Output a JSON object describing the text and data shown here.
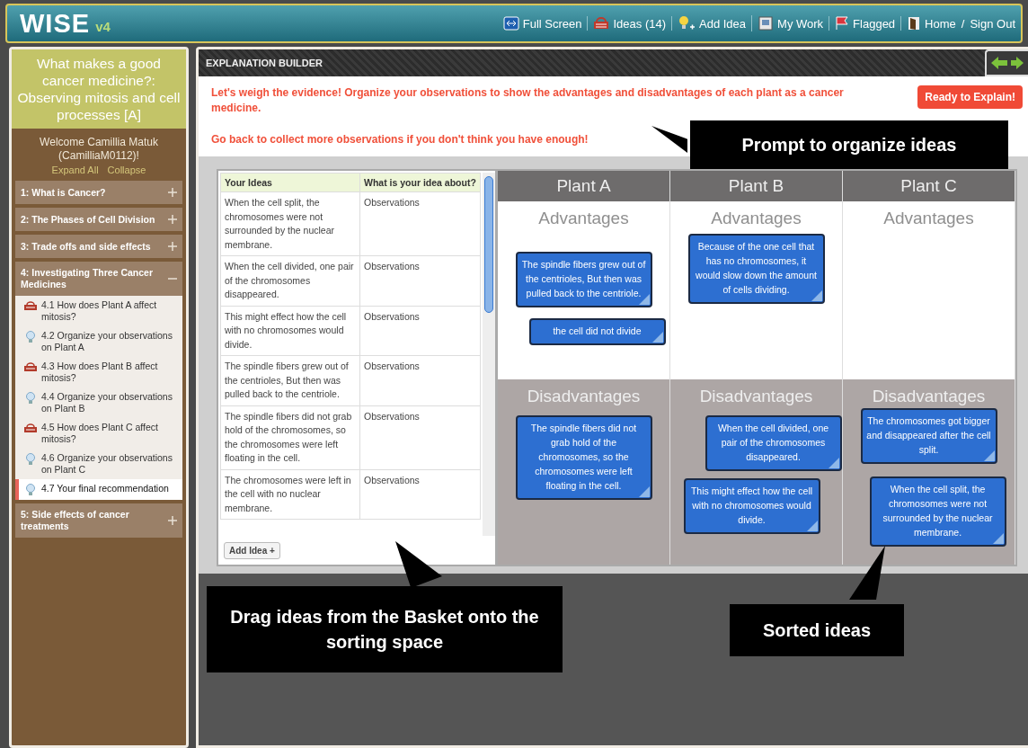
{
  "app": {
    "logo": "WISE",
    "version": "v4"
  },
  "nav": [
    {
      "kind": "fullscreen",
      "label": "Full Screen"
    },
    {
      "kind": "basket",
      "label": "Ideas (14)"
    },
    {
      "kind": "bulb",
      "label": "Add Idea"
    },
    {
      "kind": "notebook",
      "label": "My Work"
    },
    {
      "kind": "flag",
      "label": "Flagged"
    },
    {
      "kind": "door",
      "label": "Home"
    },
    {
      "kind": "slash",
      "label": "/"
    },
    {
      "kind": "plain",
      "label": "Sign Out"
    }
  ],
  "project": {
    "title": "What makes a good cancer medicine?: Observing mitosis and cell processes [A]",
    "welcome": "Welcome Camillia Matuk (CamilliaM0112)!",
    "expand_all": "Expand All",
    "collapse": "Collapse"
  },
  "sections": [
    {
      "title": "1: What is Cancer?",
      "expanded": false
    },
    {
      "title": "2: The Phases of Cell Division",
      "expanded": false
    },
    {
      "title": "3: Trade offs and side effects",
      "expanded": false
    },
    {
      "title": "4: Investigating Three Cancer Medicines",
      "expanded": true,
      "steps": [
        {
          "kind": "basket",
          "label": "4.1 How does Plant A affect mitosis?",
          "selected": false
        },
        {
          "kind": "bulb",
          "label": "4.2 Organize your observations on Plant A",
          "selected": false
        },
        {
          "kind": "basket",
          "label": "4.3 How does Plant B affect mitosis?",
          "selected": false
        },
        {
          "kind": "bulb",
          "label": "4.4 Organize your observations on Plant B",
          "selected": false
        },
        {
          "kind": "basket",
          "label": "4.5 How does Plant C affect mitosis?",
          "selected": false
        },
        {
          "kind": "bulb",
          "label": "4.6 Organize your observations on Plant C",
          "selected": false
        },
        {
          "kind": "bulb",
          "label": "4.7 Your final recommendation",
          "selected": true
        }
      ]
    },
    {
      "title": "5: Side effects of cancer treatments",
      "expanded": false
    }
  ],
  "step": {
    "title": "EXPLANATION BUILDER",
    "prompt": [
      "Let's weigh the evidence! Organize your observations to show the advantages and disadvantages of each plant as a cancer medicine.",
      "Go back to collect more observations if you don't think you have enough!"
    ],
    "ready_button": "Ready to Explain!"
  },
  "ideas_table": {
    "columns": [
      "Your Ideas",
      "What is your idea about?"
    ],
    "rows": [
      {
        "idea": "When the cell split, the chromosomes were not surrounded by the nuclear membrane.",
        "about": "Observations"
      },
      {
        "idea": "When the cell divided, one pair of the chromosomes disappeared.",
        "about": "Observations"
      },
      {
        "idea": "This might effect how the cell with no chromosomes would divide.",
        "about": "Observations"
      },
      {
        "idea": "The spindle fibers grew out of the centrioles, But then was pulled back to the centriole.",
        "about": "Observations"
      },
      {
        "idea": "The spindle fibers did not grab hold of the chromosomes, so the chromosomes were left floating in the cell.",
        "about": "Observations"
      },
      {
        "idea": "The chromosomes were left in the cell with no nuclear membrane.",
        "about": "Observations"
      }
    ],
    "add_button": "Add Idea +"
  },
  "board": {
    "columns": [
      {
        "title": "Plant A",
        "advantages_label": "Advantages",
        "disadvantages_label": "Disadvantages",
        "advantages": [
          "The spindle fibers grew out of the centrioles, But then was pulled back to the centriole.",
          "the cell did not divide"
        ],
        "disadvantages": [
          "The spindle fibers did not grab hold of the chromosomes, so the chromosomes were left floating in the cell."
        ]
      },
      {
        "title": "Plant B",
        "advantages_label": "Advantages",
        "disadvantages_label": "Disadvantages",
        "advantages": [
          "Because of the one cell that has no chromosomes, it would slow down the amount of cells dividing."
        ],
        "disadvantages": [
          "When the cell divided, one pair of the chromosomes disappeared.",
          "This might effect how the cell with no chromosomes would divide."
        ]
      },
      {
        "title": "Plant C",
        "advantages_label": "Advantages",
        "disadvantages_label": "Disadvantages",
        "disadvantages": [
          "The chromosomes got bigger and disappeared after the cell split.",
          "When the cell split, the chromosomes were not surrounded by the nuclear membrane."
        ]
      }
    ]
  },
  "callouts": [
    {
      "text": "Prompt to organize ideas"
    },
    {
      "text": "Drag ideas from the Basket onto the sorting space"
    },
    {
      "text": "Sorted ideas"
    }
  ]
}
